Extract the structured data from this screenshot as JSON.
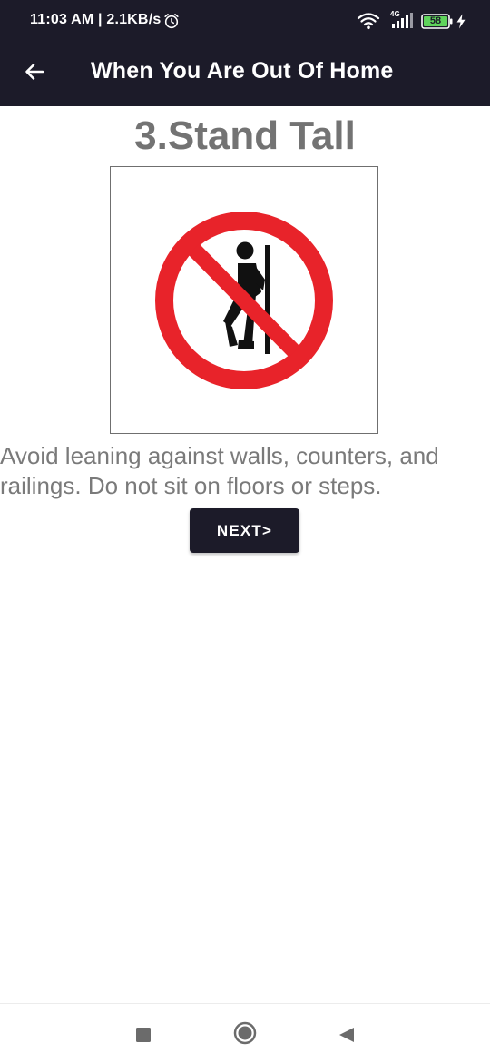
{
  "status_bar": {
    "time_speed": "11:03 AM | 2.1KB/s",
    "network_type": "4G",
    "battery_level": "58",
    "icons": [
      "alarm-icon",
      "wifi-icon",
      "signal-icon",
      "battery-icon",
      "charging-icon"
    ]
  },
  "app_bar": {
    "back_icon": "arrow-left-icon",
    "title": "When You Are Out Of Home"
  },
  "content": {
    "heading": "3.Stand Tall",
    "image_icon": "no-leaning-sign-icon",
    "description": "Avoid leaning against walls, counters, and railings. Do not sit on floors or steps.",
    "next_label": "NEXT>"
  },
  "nav_bar": {
    "icons": [
      "recent-apps-icon",
      "home-icon",
      "back-icon"
    ]
  },
  "colors": {
    "app_bar": "#1c1b29",
    "heading_text": "#737373",
    "body_text": "#7a7a7a",
    "sign_red": "#e8232a",
    "sign_black": "#111111",
    "battery_green": "#5fd35b"
  }
}
